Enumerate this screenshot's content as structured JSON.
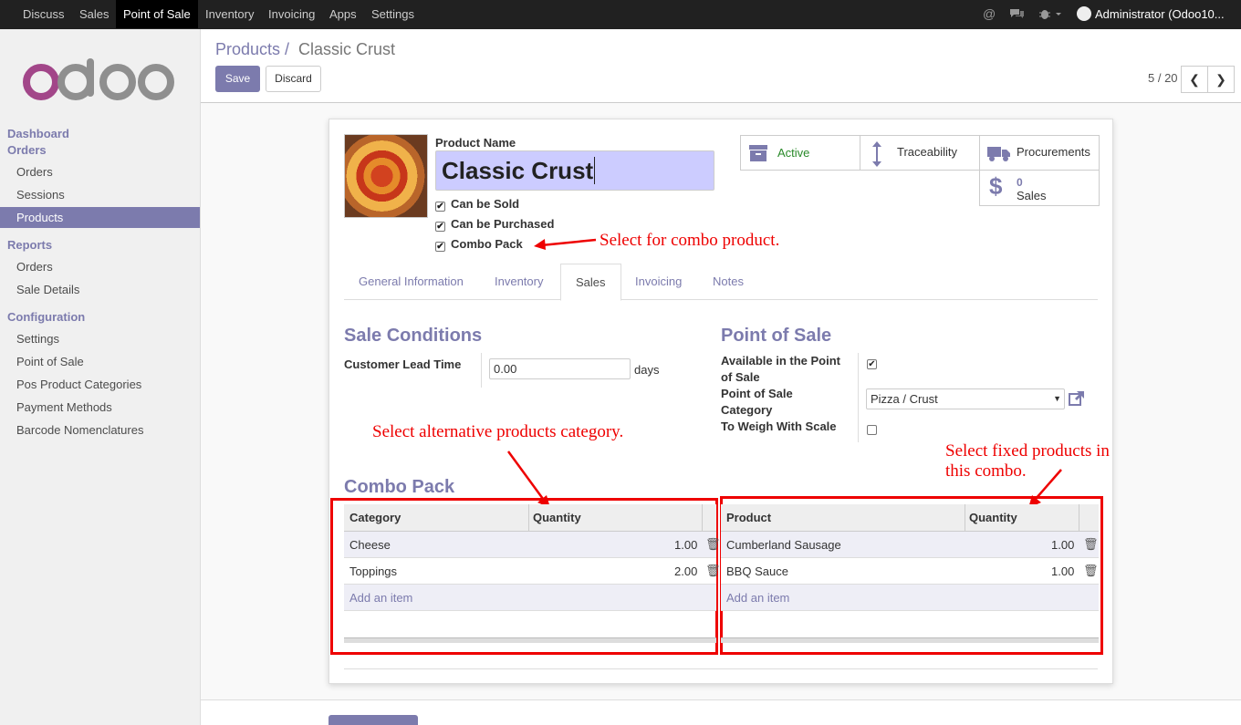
{
  "topbar": {
    "menu": [
      "Discuss",
      "Sales",
      "Point of Sale",
      "Inventory",
      "Invoicing",
      "Apps",
      "Settings"
    ],
    "active_menu": "Point of Sale",
    "user": "Administrator (Odoo10...",
    "icons": [
      "at-icon",
      "chat-icon",
      "bug-icon"
    ]
  },
  "sidebar": {
    "sections": [
      {
        "title": "Dashboard"
      },
      {
        "title": "Orders",
        "items": [
          "Orders",
          "Sessions",
          "Products"
        ]
      },
      {
        "title": "Reports",
        "items": [
          "Orders",
          "Sale Details"
        ]
      },
      {
        "title": "Configuration",
        "items": [
          "Settings",
          "Point of Sale",
          "Pos Product Categories",
          "Payment Methods",
          "Barcode Nomenclatures"
        ]
      }
    ],
    "active_item": "Products"
  },
  "control": {
    "breadcrumb_parent": "Products",
    "breadcrumb_current": "Classic Crust",
    "save_label": "Save",
    "discard_label": "Discard",
    "pager": "5 / 20"
  },
  "product": {
    "name_label": "Product Name",
    "name": "Classic Crust",
    "can_be_sold": "Can be Sold",
    "can_be_purchased": "Can be Purchased",
    "combo_pack": "Combo Pack"
  },
  "smart_buttons": {
    "active": "Active",
    "traceability": "Traceability",
    "procurements": "Procurements",
    "sales_count": "0",
    "sales_label": "Sales"
  },
  "tabs": [
    "General Information",
    "Inventory",
    "Sales",
    "Invoicing",
    "Notes"
  ],
  "active_tab": "Sales",
  "sale_conditions": {
    "title": "Sale Conditions",
    "lead_time_label": "Customer Lead Time",
    "lead_time_value": "0.00",
    "lead_time_unit": "days"
  },
  "pos": {
    "title": "Point of Sale",
    "available_label": "Available in the Point of Sale",
    "category_label": "Point of Sale Category",
    "category_value": "Pizza / Crust",
    "weigh_label": "To Weigh With Scale"
  },
  "combo": {
    "title": "Combo Pack",
    "left_headers": [
      "Category",
      "Quantity"
    ],
    "left_rows": [
      [
        "Cheese",
        "1.00"
      ],
      [
        "Toppings",
        "2.00"
      ]
    ],
    "right_headers": [
      "Product",
      "Quantity"
    ],
    "right_rows": [
      [
        "Cumberland Sausage",
        "1.00"
      ],
      [
        "BBQ Sauce",
        "1.00"
      ]
    ],
    "add_item": "Add an item"
  },
  "annotations": {
    "combo": "Select for combo product.",
    "category": "Select alternative products category.",
    "fixed": "Select fixed products in this combo."
  },
  "colors": {
    "brand": "#7c7bad",
    "annotation": "#ee0000",
    "topbar": "#212121"
  }
}
